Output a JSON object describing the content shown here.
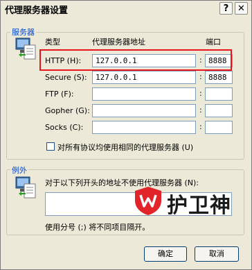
{
  "window": {
    "title": "代理服务器设置",
    "help_label": "?",
    "close_label": "✕"
  },
  "servers": {
    "group_label": "服务器",
    "col_type": "类型",
    "col_address": "代理服务器地址",
    "col_port": "端口",
    "rows": [
      {
        "label": "HTTP (H):",
        "address": "127.0.0.1",
        "port": "8888"
      },
      {
        "label": "Secure (S):",
        "address": "127.0.0.1",
        "port": "8888"
      },
      {
        "label": "FTP (F):",
        "address": "",
        "port": ""
      },
      {
        "label": "Gopher (G):",
        "address": "",
        "port": ""
      },
      {
        "label": "Socks (C):",
        "address": "",
        "port": ""
      }
    ],
    "same_proxy_label": "对所有协议均使用相同的代理服务器 (U)"
  },
  "exceptions": {
    "group_label": "例外",
    "desc": "对于以下列开头的地址不使用代理服务器 (N):",
    "value": "",
    "hint": "使用分号 (;) 将不同项目隔开。"
  },
  "watermark": {
    "text": "护卫神"
  },
  "buttons": {
    "ok": "确定",
    "cancel": "取消"
  },
  "colors": {
    "group_label": "#0046d5",
    "highlight": "#e8141c",
    "dialog_bg": "#ece9d8"
  }
}
